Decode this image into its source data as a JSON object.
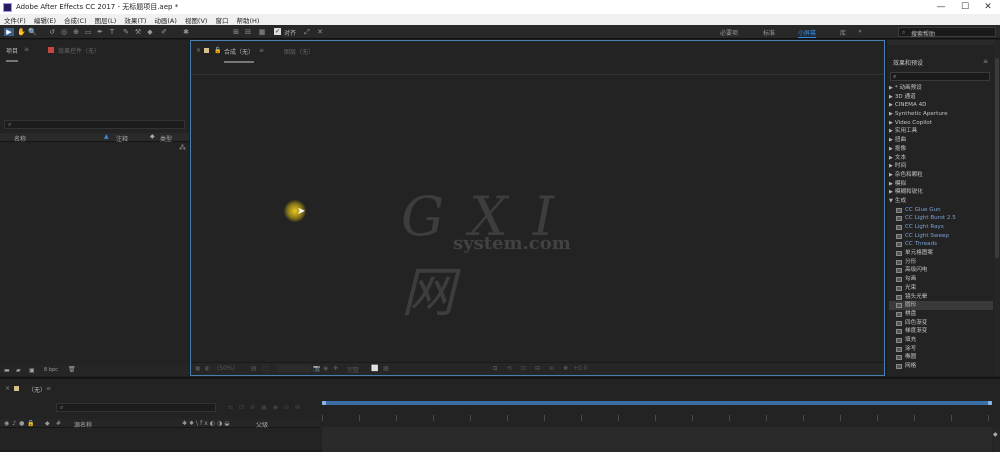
{
  "window": {
    "title": "Adobe After Effects CC 2017 - 无标题项目.aep *"
  },
  "menu": [
    "文件(F)",
    "编辑(E)",
    "合成(C)",
    "图层(L)",
    "效果(T)",
    "动画(A)",
    "视图(V)",
    "窗口",
    "帮助(H)"
  ],
  "toolbar": {
    "align_label": "对齐"
  },
  "workspaces": [
    "必要项",
    "标准",
    "小屏幕",
    "库"
  ],
  "search_help": {
    "placeholder": "搜索帮助"
  },
  "project_panel": {
    "tab_project": "项目",
    "tab_effect_controls": "效果控件（无）",
    "columns": [
      "名称",
      "注释",
      "类型"
    ],
    "bpc": "8 bpc"
  },
  "comp_panel": {
    "tab_comp": "合成（无）",
    "tab_layer": "图层（无）",
    "zoom": "(50%)",
    "quality": "完整",
    "exposure": "+0.0"
  },
  "effects_panel": {
    "tab": "效果和预设",
    "categories": [
      "* 动画预设",
      "3D 通道",
      "CINEMA 4D",
      "Synthetic Aperture",
      "Video Copilot",
      "实用工具",
      "扭曲",
      "抠像",
      "文本",
      "时间",
      "杂色和颗粒",
      "模拟",
      "模糊和锐化",
      "生成"
    ],
    "generate_items": [
      "CC Glue Gun",
      "CC Light Burst 2.5",
      "CC Light Rays",
      "CC Light Sweep",
      "CC Threads",
      "单元格图案",
      "分形",
      "高级闪电",
      "勾画",
      "光束",
      "镜头光晕",
      "圆形",
      "棋盘",
      "四色渐变",
      "梯度渐变",
      "填充",
      "涂写",
      "椭圆",
      "网格"
    ],
    "selected_index": 12
  },
  "timeline": {
    "tab": "（无）",
    "layer_name_header": "源名称",
    "parent_header": "父级"
  },
  "watermark": {
    "big": "G X I 网",
    "small": "system.com"
  },
  "colors": {
    "accent": "#2d8ceb",
    "panel_bg": "#232323",
    "border_active": "#4a7fb5"
  }
}
